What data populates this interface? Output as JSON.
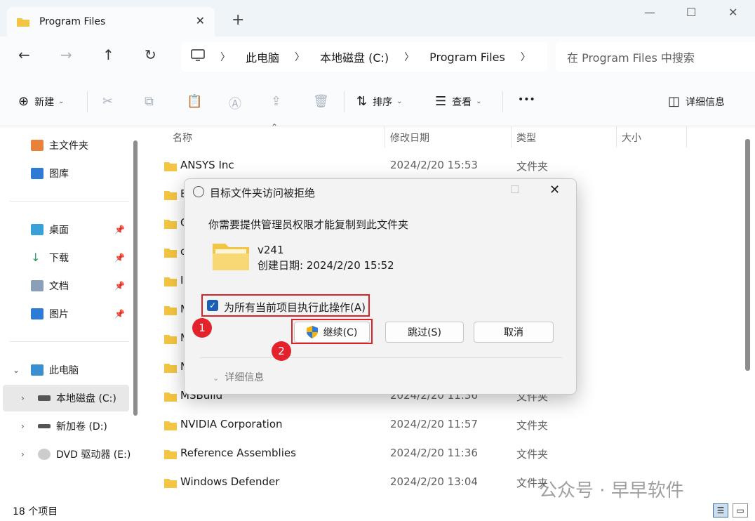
{
  "window": {
    "tab_title": "Program Files",
    "tab_close": "✕",
    "new_tab": "+",
    "minimize": "—",
    "maximize": "☐",
    "close": "✕"
  },
  "nav": {
    "back_icon": "arrow-left-icon",
    "breadcrumb": [
      "此电脑",
      "本地磁盘 (C:)",
      "Program Files"
    ],
    "search_placeholder": "在 Program Files 中搜索"
  },
  "toolbar": {
    "new_label": "新建",
    "sort_label": "排序",
    "view_label": "查看",
    "more_label": "•••",
    "details_label": "详细信息"
  },
  "sidebar": {
    "items": [
      {
        "label": "主文件夹"
      },
      {
        "label": "图库"
      },
      {
        "label": "桌面"
      },
      {
        "label": "下载"
      },
      {
        "label": "文档"
      },
      {
        "label": "图片"
      },
      {
        "label": "此电脑"
      },
      {
        "label": "本地磁盘 (C:)"
      },
      {
        "label": "新加卷 (D:)"
      },
      {
        "label": "DVD 驱动器 (E:)"
      }
    ]
  },
  "columns": {
    "name": "名称",
    "modified": "修改日期",
    "type": "类型",
    "size": "大小"
  },
  "files": [
    {
      "name": "ANSYS Inc",
      "date": "2024/2/20 15:53",
      "type": "文件夹"
    },
    {
      "name": "B",
      "date": "",
      "type": ""
    },
    {
      "name": "C",
      "date": "",
      "type": ""
    },
    {
      "name": "c",
      "date": "",
      "type": ""
    },
    {
      "name": "In",
      "date": "",
      "type": ""
    },
    {
      "name": "M",
      "date": "",
      "type": ""
    },
    {
      "name": "M",
      "date": "",
      "type": ""
    },
    {
      "name": "N",
      "date": "",
      "type": ""
    },
    {
      "name": "MSBuild",
      "date": "2024/2/20 11:36",
      "type": "文件夹"
    },
    {
      "name": "NVIDIA Corporation",
      "date": "2024/2/20 11:57",
      "type": "文件夹"
    },
    {
      "name": "Reference Assemblies",
      "date": "2024/2/20 11:36",
      "type": "文件夹"
    },
    {
      "name": "Windows Defender",
      "date": "2024/2/20 13:04",
      "type": "文件夹"
    }
  ],
  "status": {
    "item_count": "18 个项目"
  },
  "watermark": "公众号 · 早早软件",
  "dialog": {
    "title": "目标文件夹访问被拒绝",
    "message": "你需要提供管理员权限才能复制到此文件夹",
    "folder_name": "v241",
    "folder_created": "创建日期: 2024/2/20 15:52",
    "checkbox_label": "为所有当前项目执行此操作(A)",
    "checkbox_checked": true,
    "continue_label": "继续(C)",
    "skip_label": "跳过(S)",
    "cancel_label": "取消",
    "details_label": "详细信息",
    "markers": [
      "1",
      "2"
    ]
  },
  "colors": {
    "folder_yellow": "#f4c542",
    "highlight_red": "#d8232a",
    "accent_blue": "#1a5fb4"
  }
}
